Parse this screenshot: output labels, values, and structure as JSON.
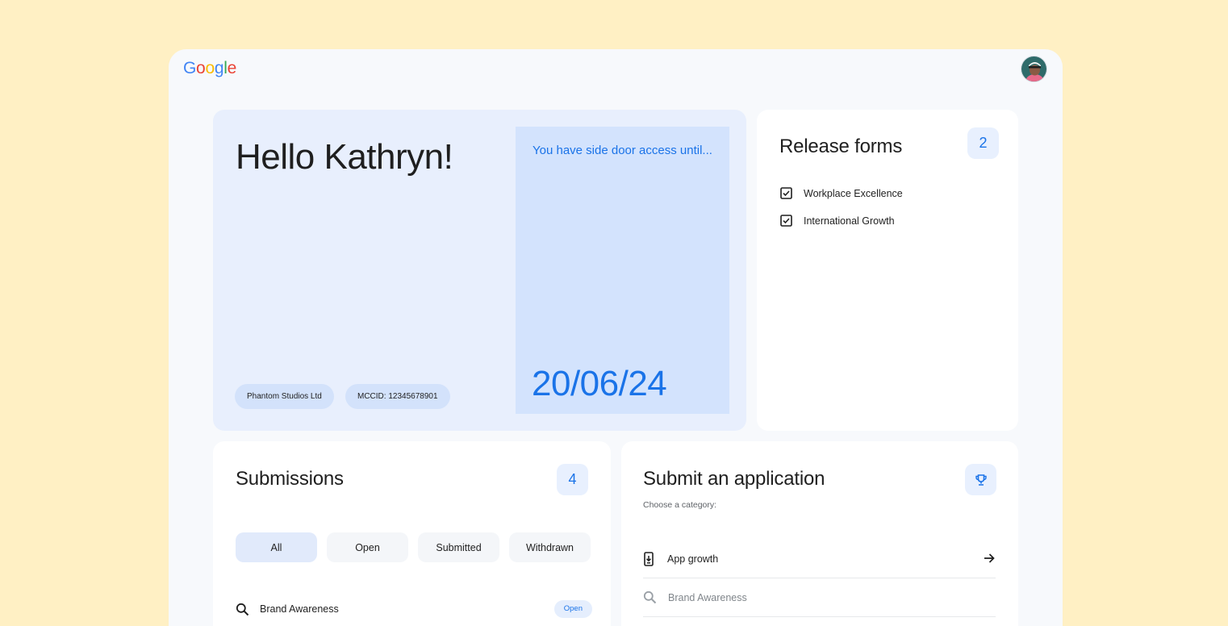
{
  "header": {
    "logo_letters": [
      "G",
      "o",
      "o",
      "g",
      "l",
      "e"
    ],
    "logo_colors": [
      "#4285F4",
      "#EA4335",
      "#FBBC05",
      "#4285F4",
      "#34A853",
      "#EA4335"
    ],
    "avatar_icon": "user-avatar"
  },
  "greeting": {
    "title": "Hello Kathryn!",
    "company": "Phantom Studios Ltd",
    "mccid": "MCCID: 12345678901"
  },
  "access": {
    "title": "You have side door access until...",
    "date": "20/06/24"
  },
  "release_forms": {
    "title": "Release forms",
    "count": "2",
    "items": [
      {
        "label": "Workplace Excellence",
        "icon": "checkbox-checked-icon"
      },
      {
        "label": "International Growth",
        "icon": "checkbox-checked-icon"
      }
    ]
  },
  "submissions": {
    "title": "Submissions",
    "count": "4",
    "tabs": [
      {
        "label": "All",
        "active": true
      },
      {
        "label": "Open",
        "active": false
      },
      {
        "label": "Submitted",
        "active": false
      },
      {
        "label": "Withdrawn",
        "active": false
      }
    ],
    "rows": [
      {
        "label": "Brand Awareness",
        "status": "Open",
        "icon": "search-icon"
      }
    ]
  },
  "application": {
    "title": "Submit an application",
    "subtitle": "Choose a category:",
    "badge_icon": "trophy-icon",
    "categories": [
      {
        "label": "App growth",
        "icon": "phone-download-icon"
      },
      {
        "label": "Brand Awareness",
        "icon": "search-icon"
      }
    ]
  },
  "colors": {
    "accent": "#1a73e8",
    "page_bg": "#fff0c4",
    "hello_card": "#e8effd",
    "access_card": "#d3e3fd"
  }
}
